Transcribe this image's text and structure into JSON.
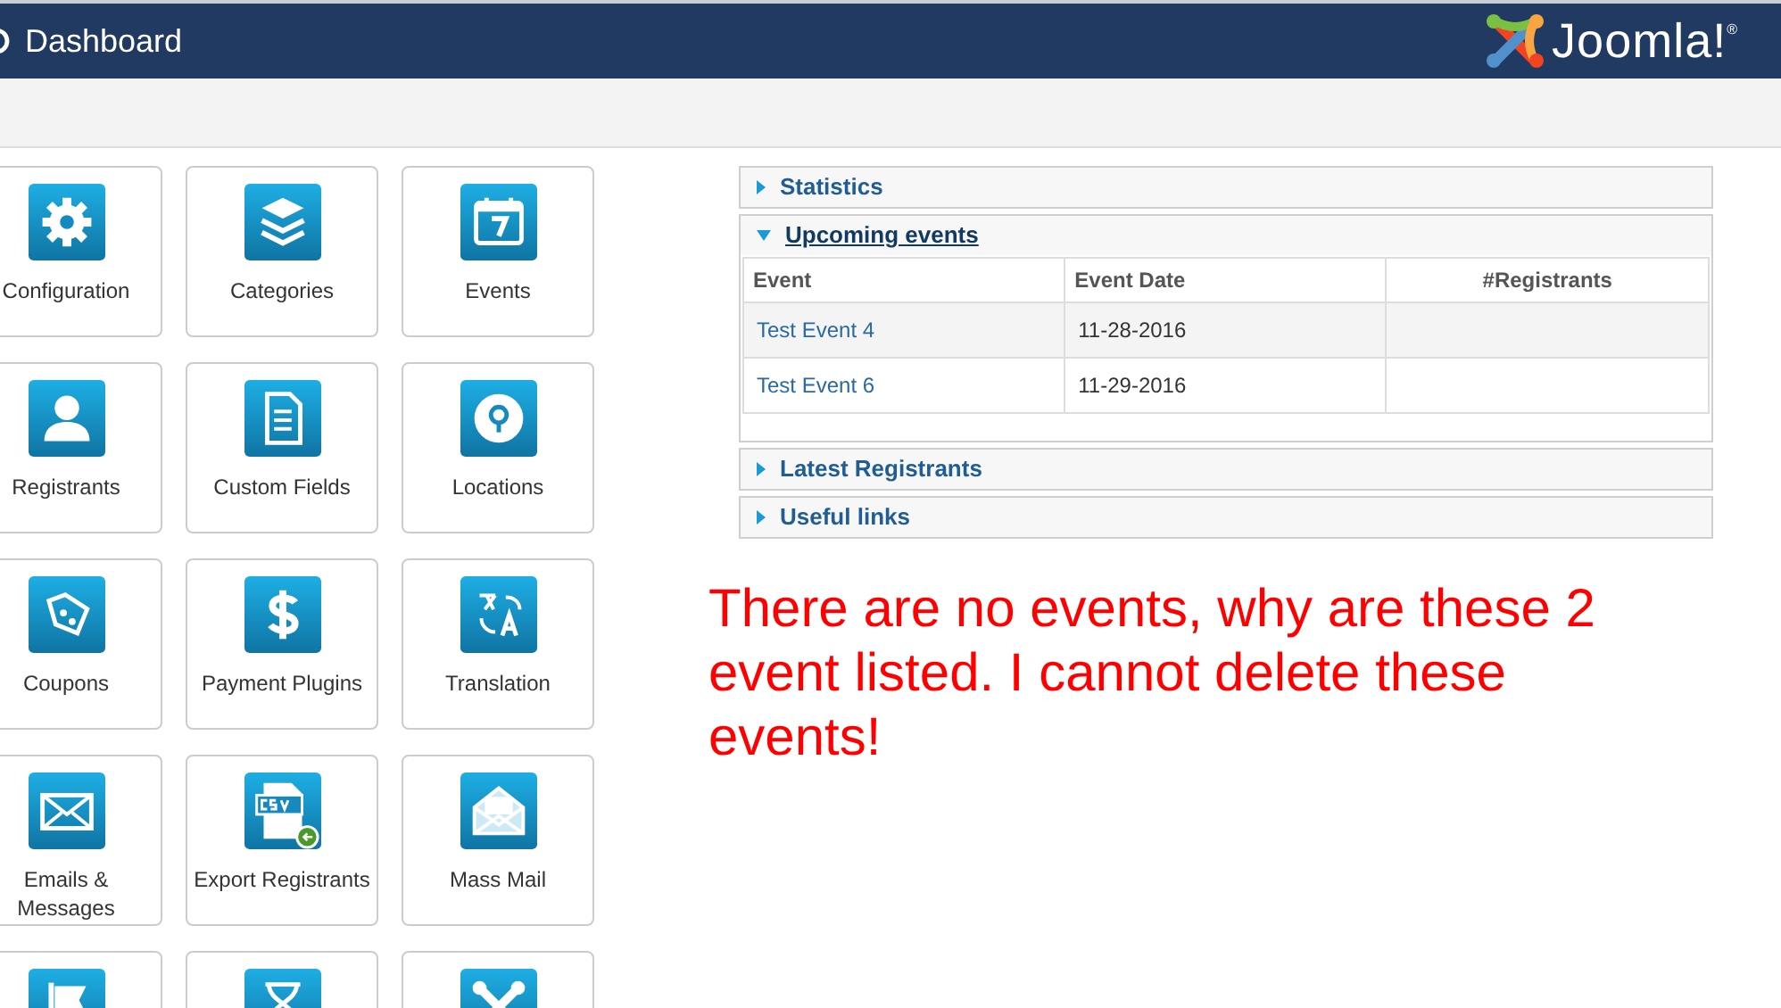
{
  "header": {
    "title": "Dashboard",
    "brand": "Joomla!$^{®}$"
  },
  "tiles": [
    {
      "kind": "labeled",
      "label": "Configuration"
    },
    {
      "kind": "labeled",
      "label": "Categories"
    },
    {
      "kind": "labeled",
      "label": "Events"
    },
    {
      "kind": "labeled",
      "label": "Registrants"
    },
    {
      "kind": "labeled",
      "label": "Custom Fields"
    },
    {
      "kind": "labeled",
      "label": "Locations"
    },
    {
      "kind": "labeled",
      "label": "Coupons"
    },
    {
      "kind": "labeled",
      "label": "Payment Plugins"
    },
    {
      "kind": "labeled",
      "label": "Translation"
    },
    {
      "kind": "labeled",
      "label": "Emails & Messages"
    },
    {
      "kind": "labeled",
      "label": "Export Registrants"
    },
    {
      "kind": "labeled",
      "label": "Mass Mail"
    },
    {
      "kind": "cut"
    },
    {
      "kind": "cut"
    },
    {
      "kind": "cut"
    }
  ],
  "panels": [
    {
      "title": "Statistics",
      "expanded": false
    },
    {
      "title": "Upcoming events",
      "expanded": true,
      "table": {
        "columns": [
          "Event",
          "Event Date",
          "#Registrants"
        ],
        "rows": [
          [
            "Test Event 4",
            "11-28-2016",
            ""
          ],
          [
            "Test Event 6",
            "11-29-2016",
            ""
          ]
        ]
      }
    },
    {
      "title": "Latest Registrants",
      "expanded": false
    },
    {
      "title": "Useful links",
      "expanded": false
    }
  ],
  "annotation": "There are no events, why are these 2 event listed. I cannot delete these events!"
}
